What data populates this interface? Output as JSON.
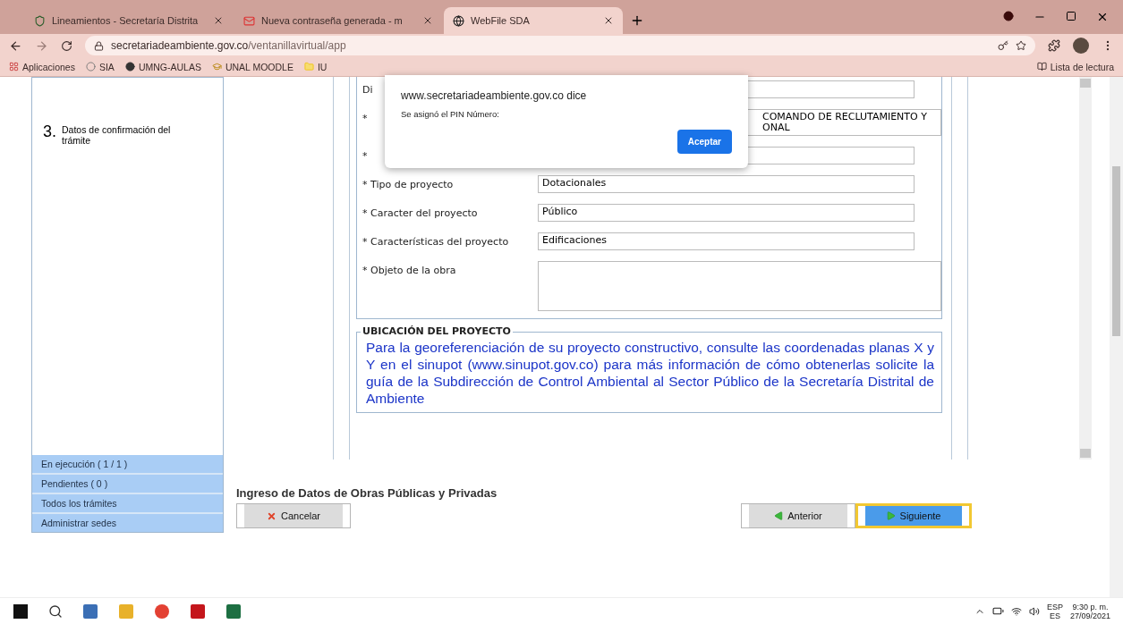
{
  "browser": {
    "tabs": [
      {
        "title": "Lineamientos - Secretaría Distrita",
        "selected": false
      },
      {
        "title": "Nueva contraseña generada - m",
        "selected": false
      },
      {
        "title": "WebFile SDA",
        "selected": true
      }
    ],
    "address": "secretariadeambiente.gov.co",
    "address_path": "/ventanillavirtual/app",
    "bookmarks": [
      {
        "label": "Aplicaciones"
      },
      {
        "label": "SIA"
      },
      {
        "label": "UMNG-AULAS"
      },
      {
        "label": "UNAL MOODLE"
      },
      {
        "label": "IU"
      }
    ],
    "reading_list": "Lista de lectura"
  },
  "sidebar": {
    "step": {
      "number": "3.",
      "label": "Datos de confirmación del trámite"
    },
    "nav": [
      {
        "label": "En ejecución ( 1 / 1 )"
      },
      {
        "label": "Pendientes ( 0 )"
      },
      {
        "label": "Todos los trámites"
      },
      {
        "label": "Administrar sedes"
      }
    ]
  },
  "form": {
    "rows": [
      {
        "label": "Di",
        "value": "",
        "kind": "line"
      },
      {
        "label": "*",
        "value": "COMANDO DE RECLUTAMIENTO Y\nONAL",
        "kind": "covered"
      },
      {
        "label": "*",
        "value": "",
        "kind": "line"
      },
      {
        "label": "* Tipo de proyecto",
        "value": "Dotacionales",
        "kind": "line"
      },
      {
        "label": "* Caracter del proyecto",
        "value": "Público",
        "kind": "line"
      },
      {
        "label": "* Características del proyecto",
        "value": "Edificaciones",
        "kind": "line"
      },
      {
        "label": "* Objeto de la obra",
        "value": "",
        "kind": "area"
      }
    ]
  },
  "location": {
    "legend": "UBICACIÓN DEL PROYECTO",
    "text": "Para la georeferenciación de su proyecto constructivo, consulte las coordenadas planas X y Y en el sinupot (www.sinupot.gov.co) para más información de cómo obtenerlas solicite la guía de la Subdirección de Control Ambiental al Sector Público de la Secretaría Distrital de Ambiente"
  },
  "page_title": "Ingreso de Datos de Obras Públicas y Privadas",
  "buttons": [
    {
      "label": "Cancelar",
      "kind": "cancel",
      "focused": false
    },
    {
      "label": "Anterior",
      "kind": "prev",
      "focused": false
    },
    {
      "label": "Siguiente",
      "kind": "next",
      "focused": true
    }
  ],
  "dialog": {
    "title": "www.secretariadeambiente.gov.co dice",
    "message": "Se asignó el PIN Número:",
    "button": "Aceptar"
  },
  "taskbar": {
    "lang": "ESP",
    "lang2": "ES",
    "time": "9:30 p. m.",
    "date": "27/09/2021"
  }
}
